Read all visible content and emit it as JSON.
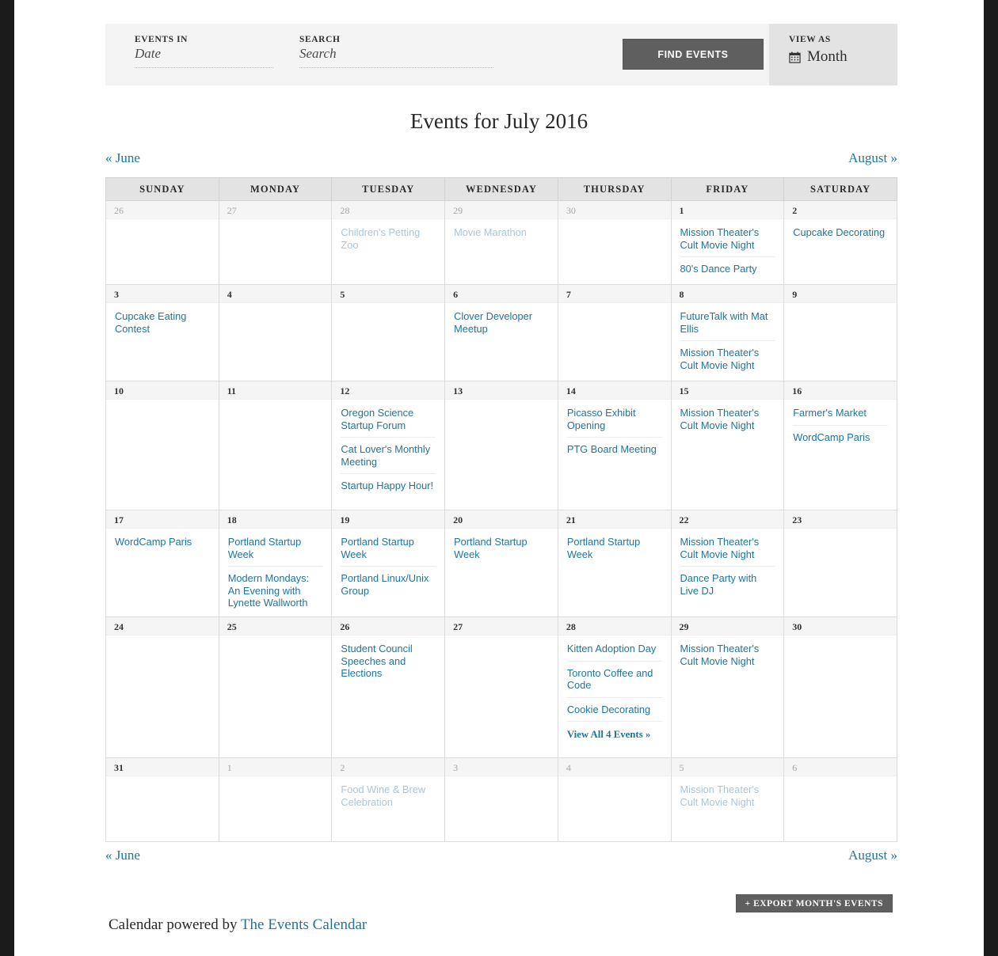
{
  "filters": {
    "events_in_label": "EVENTS IN",
    "events_in_placeholder": "Date",
    "events_in_value": "",
    "search_label": "SEARCH",
    "search_placeholder": "Search",
    "search_value": "",
    "find_events_label": "FIND EVENTS",
    "view_as_label": "VIEW AS",
    "view_as_value": "Month",
    "view_as_icon": "calendar-icon"
  },
  "title": "Events for July 2016",
  "nav": {
    "prev": "« June",
    "next": "August »"
  },
  "weekday_headers": [
    "SUNDAY",
    "MONDAY",
    "TUESDAY",
    "WEDNESDAY",
    "THURSDAY",
    "FRIDAY",
    "SATURDAY"
  ],
  "accent_color": "#21759b",
  "weeks": [
    {
      "row": 1,
      "days": [
        {
          "num": "26",
          "out": true,
          "events": []
        },
        {
          "num": "27",
          "out": true,
          "events": []
        },
        {
          "num": "28",
          "out": true,
          "events": [
            {
              "title": "Children's Petting Zoo"
            }
          ]
        },
        {
          "num": "29",
          "out": true,
          "events": [
            {
              "title": "Movie Marathon"
            }
          ]
        },
        {
          "num": "30",
          "out": true,
          "events": []
        },
        {
          "num": "1",
          "out": false,
          "events": [
            {
              "title": "Mission Theater's Cult Movie Night"
            },
            {
              "title": "80's Dance Party"
            }
          ]
        },
        {
          "num": "2",
          "out": false,
          "events": [
            {
              "title": "Cupcake Decorating"
            }
          ]
        }
      ]
    },
    {
      "row": 2,
      "days": [
        {
          "num": "3",
          "out": false,
          "events": [
            {
              "title": "Cupcake Eating Contest"
            }
          ]
        },
        {
          "num": "4",
          "out": false,
          "events": []
        },
        {
          "num": "5",
          "out": false,
          "events": []
        },
        {
          "num": "6",
          "out": false,
          "events": [
            {
              "title": "Clover Developer Meetup"
            }
          ]
        },
        {
          "num": "7",
          "out": false,
          "events": []
        },
        {
          "num": "8",
          "out": false,
          "events": [
            {
              "title": "FutureTalk with Mat Ellis"
            },
            {
              "title": "Mission Theater's Cult Movie Night"
            }
          ]
        },
        {
          "num": "9",
          "out": false,
          "events": []
        }
      ]
    },
    {
      "row": 3,
      "days": [
        {
          "num": "10",
          "out": false,
          "events": []
        },
        {
          "num": "11",
          "out": false,
          "events": []
        },
        {
          "num": "12",
          "out": false,
          "events": [
            {
              "title": "Oregon Science Startup Forum"
            },
            {
              "title": "Cat Lover's Monthly Meeting"
            },
            {
              "title": "Startup Happy Hour!"
            }
          ]
        },
        {
          "num": "13",
          "out": false,
          "events": []
        },
        {
          "num": "14",
          "out": false,
          "events": [
            {
              "title": "Picasso Exhibit Opening"
            },
            {
              "title": "PTG Board Meeting"
            }
          ]
        },
        {
          "num": "15",
          "out": false,
          "events": [
            {
              "title": "Mission Theater's Cult Movie Night"
            }
          ]
        },
        {
          "num": "16",
          "out": false,
          "events": [
            {
              "title": "Farmer's Market"
            },
            {
              "title": "WordCamp Paris"
            }
          ]
        }
      ]
    },
    {
      "row": 4,
      "days": [
        {
          "num": "17",
          "out": false,
          "events": [
            {
              "title": "WordCamp Paris"
            }
          ]
        },
        {
          "num": "18",
          "out": false,
          "events": [
            {
              "title": "Portland Startup Week"
            },
            {
              "title": "Modern Mondays: An Evening with Lynette Wallworth"
            }
          ]
        },
        {
          "num": "19",
          "out": false,
          "events": [
            {
              "title": "Portland Startup Week"
            },
            {
              "title": "Portland Linux/Unix Group"
            }
          ]
        },
        {
          "num": "20",
          "out": false,
          "events": [
            {
              "title": "Portland Startup Week"
            }
          ]
        },
        {
          "num": "21",
          "out": false,
          "events": [
            {
              "title": "Portland Startup Week"
            }
          ]
        },
        {
          "num": "22",
          "out": false,
          "events": [
            {
              "title": "Mission Theater's Cult Movie Night"
            },
            {
              "title": "Dance Party with Live DJ"
            }
          ]
        },
        {
          "num": "23",
          "out": false,
          "events": []
        }
      ]
    },
    {
      "row": 5,
      "days": [
        {
          "num": "24",
          "out": false,
          "events": []
        },
        {
          "num": "25",
          "out": false,
          "events": []
        },
        {
          "num": "26",
          "out": false,
          "events": [
            {
              "title": "Student Council Speeches and Elections"
            }
          ]
        },
        {
          "num": "27",
          "out": false,
          "events": []
        },
        {
          "num": "28",
          "out": false,
          "events": [
            {
              "title": "Kitten Adoption Day"
            },
            {
              "title": "Toronto Coffee and Code"
            },
            {
              "title": "Cookie Decorating"
            }
          ],
          "view_all": "View All 4 Events »"
        },
        {
          "num": "29",
          "out": false,
          "events": [
            {
              "title": "Mission Theater's Cult Movie Night"
            }
          ]
        },
        {
          "num": "30",
          "out": false,
          "events": []
        }
      ]
    },
    {
      "row": 6,
      "days": [
        {
          "num": "31",
          "out": false,
          "events": []
        },
        {
          "num": "1",
          "out": true,
          "events": []
        },
        {
          "num": "2",
          "out": true,
          "events": [
            {
              "title": "Food Wine & Brew Celebration"
            }
          ]
        },
        {
          "num": "3",
          "out": true,
          "events": []
        },
        {
          "num": "4",
          "out": true,
          "events": []
        },
        {
          "num": "5",
          "out": true,
          "events": [
            {
              "title": "Mission Theater's Cult Movie Night"
            }
          ]
        },
        {
          "num": "6",
          "out": true,
          "events": []
        }
      ]
    }
  ],
  "footer": {
    "export_label": "+ EXPORT MONTH'S EVENTS",
    "powered_by_prefix": "Calendar powered by ",
    "powered_by_link": "The Events Calendar"
  }
}
